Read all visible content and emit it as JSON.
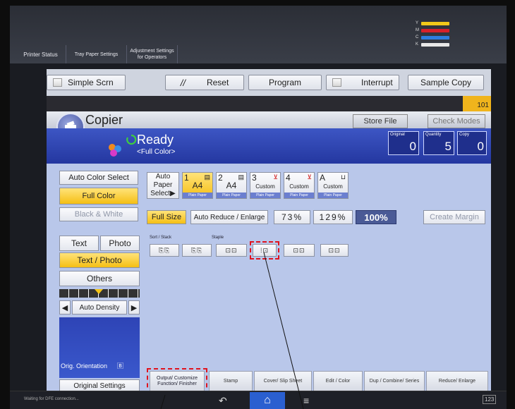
{
  "top_tabs": [
    "Printer Status",
    "Tray Paper Settings",
    "Adjustment Settings for Operators"
  ],
  "toner": [
    {
      "label": "Y",
      "color": "#f2c81a"
    },
    {
      "label": "M",
      "color": "#d8202a"
    },
    {
      "label": "C",
      "color": "#2d7de0"
    },
    {
      "label": "K",
      "color": "#e8e8e8"
    }
  ],
  "toolbar": {
    "simple_scrn": "Simple Scrn",
    "reset": "Reset",
    "program": "Program",
    "interrupt": "Interrupt",
    "sample_copy": "Sample Copy"
  },
  "counter": "101",
  "header": {
    "title": "Copier",
    "store_file": "Store File",
    "check_modes": "Check Modes"
  },
  "status": {
    "ready": "Ready",
    "mode": "<Full Color>"
  },
  "counts": {
    "original_label": "Original",
    "original_value": "0",
    "quantity_label": "Quantity",
    "quantity_value": "5",
    "copy_label": "Copy",
    "copy_value": "0"
  },
  "color_modes": {
    "auto": "Auto Color Select",
    "full": "Full Color",
    "bw": "Black & White"
  },
  "paper": {
    "auto_select": "Auto Paper Select▶",
    "trays": [
      {
        "num": "1",
        "size": "A4",
        "type": "Plain Paper"
      },
      {
        "num": "2",
        "size": "A4",
        "type": "Plain Paper"
      },
      {
        "num": "3",
        "size": "Custom Size",
        "type": "Plain Paper"
      },
      {
        "num": "4",
        "size": "Custom Size",
        "type": "Plain Paper"
      },
      {
        "num": "A",
        "size": "Custom Size",
        "type": "Plain Paper"
      }
    ]
  },
  "reduce": {
    "full_size": "Full Size",
    "auto_reduce": "Auto Reduce / Enlarge",
    "p73": "73%",
    "p129": "129%",
    "p100": "100%",
    "create_margin": "Create Margin"
  },
  "original_type": {
    "text": "Text",
    "photo": "Photo",
    "text_photo": "Text / Photo",
    "others": "Others"
  },
  "density": {
    "label": "Auto Density"
  },
  "finisher": {
    "sort_label": "Sort / Stack",
    "staple_label": "Staple"
  },
  "orig_orientation": "Orig. Orientation",
  "original_settings": "Original Settings",
  "bottom_tabs": [
    "Output/ Customize Function/ Finisher",
    "Stamp",
    "Cover/ Slip Sheet",
    "Edit / Color",
    "Dup / Combine/ Series",
    "Reduce/ Enlarge"
  ],
  "status_bar": "Waiting for DFE connection...",
  "keypad_label": "123"
}
